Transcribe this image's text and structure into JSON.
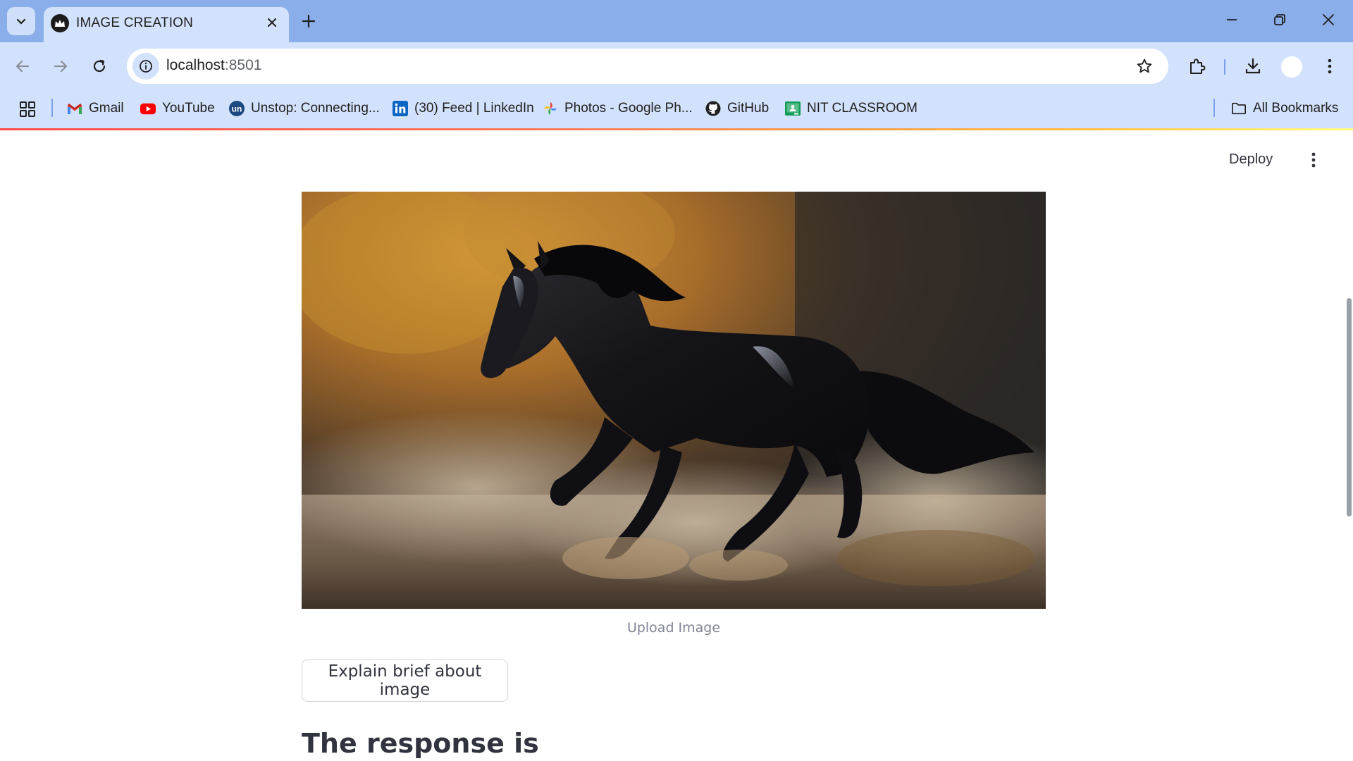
{
  "browser": {
    "tab": {
      "title": "IMAGE CREATION"
    },
    "address_bar": {
      "host": "localhost",
      "port": ":8501"
    },
    "bookmarks": [
      {
        "label": "Gmail",
        "icon": "gmail-icon"
      },
      {
        "label": "YouTube",
        "icon": "youtube-icon"
      },
      {
        "label": "Unstop: Connecting...",
        "icon": "unstop-icon"
      },
      {
        "label": "(30) Feed | LinkedIn",
        "icon": "linkedin-icon"
      },
      {
        "label": "Photos - Google Ph...",
        "icon": "google-photos-icon"
      },
      {
        "label": "GitHub",
        "icon": "github-icon"
      },
      {
        "label": "NIT CLASSROOM",
        "icon": "classroom-icon"
      }
    ],
    "all_bookmarks_label": "All Bookmarks"
  },
  "app": {
    "deploy_label": "Deploy",
    "image_caption": "Upload Image",
    "explain_button_label": "Explain brief about image",
    "response_heading": "The response is"
  },
  "colors": {
    "tabstrip_bg": "#8aaee9",
    "toolbar_bg": "#d3e2fc",
    "text_primary": "#31333f",
    "caption_text": "#808495"
  }
}
